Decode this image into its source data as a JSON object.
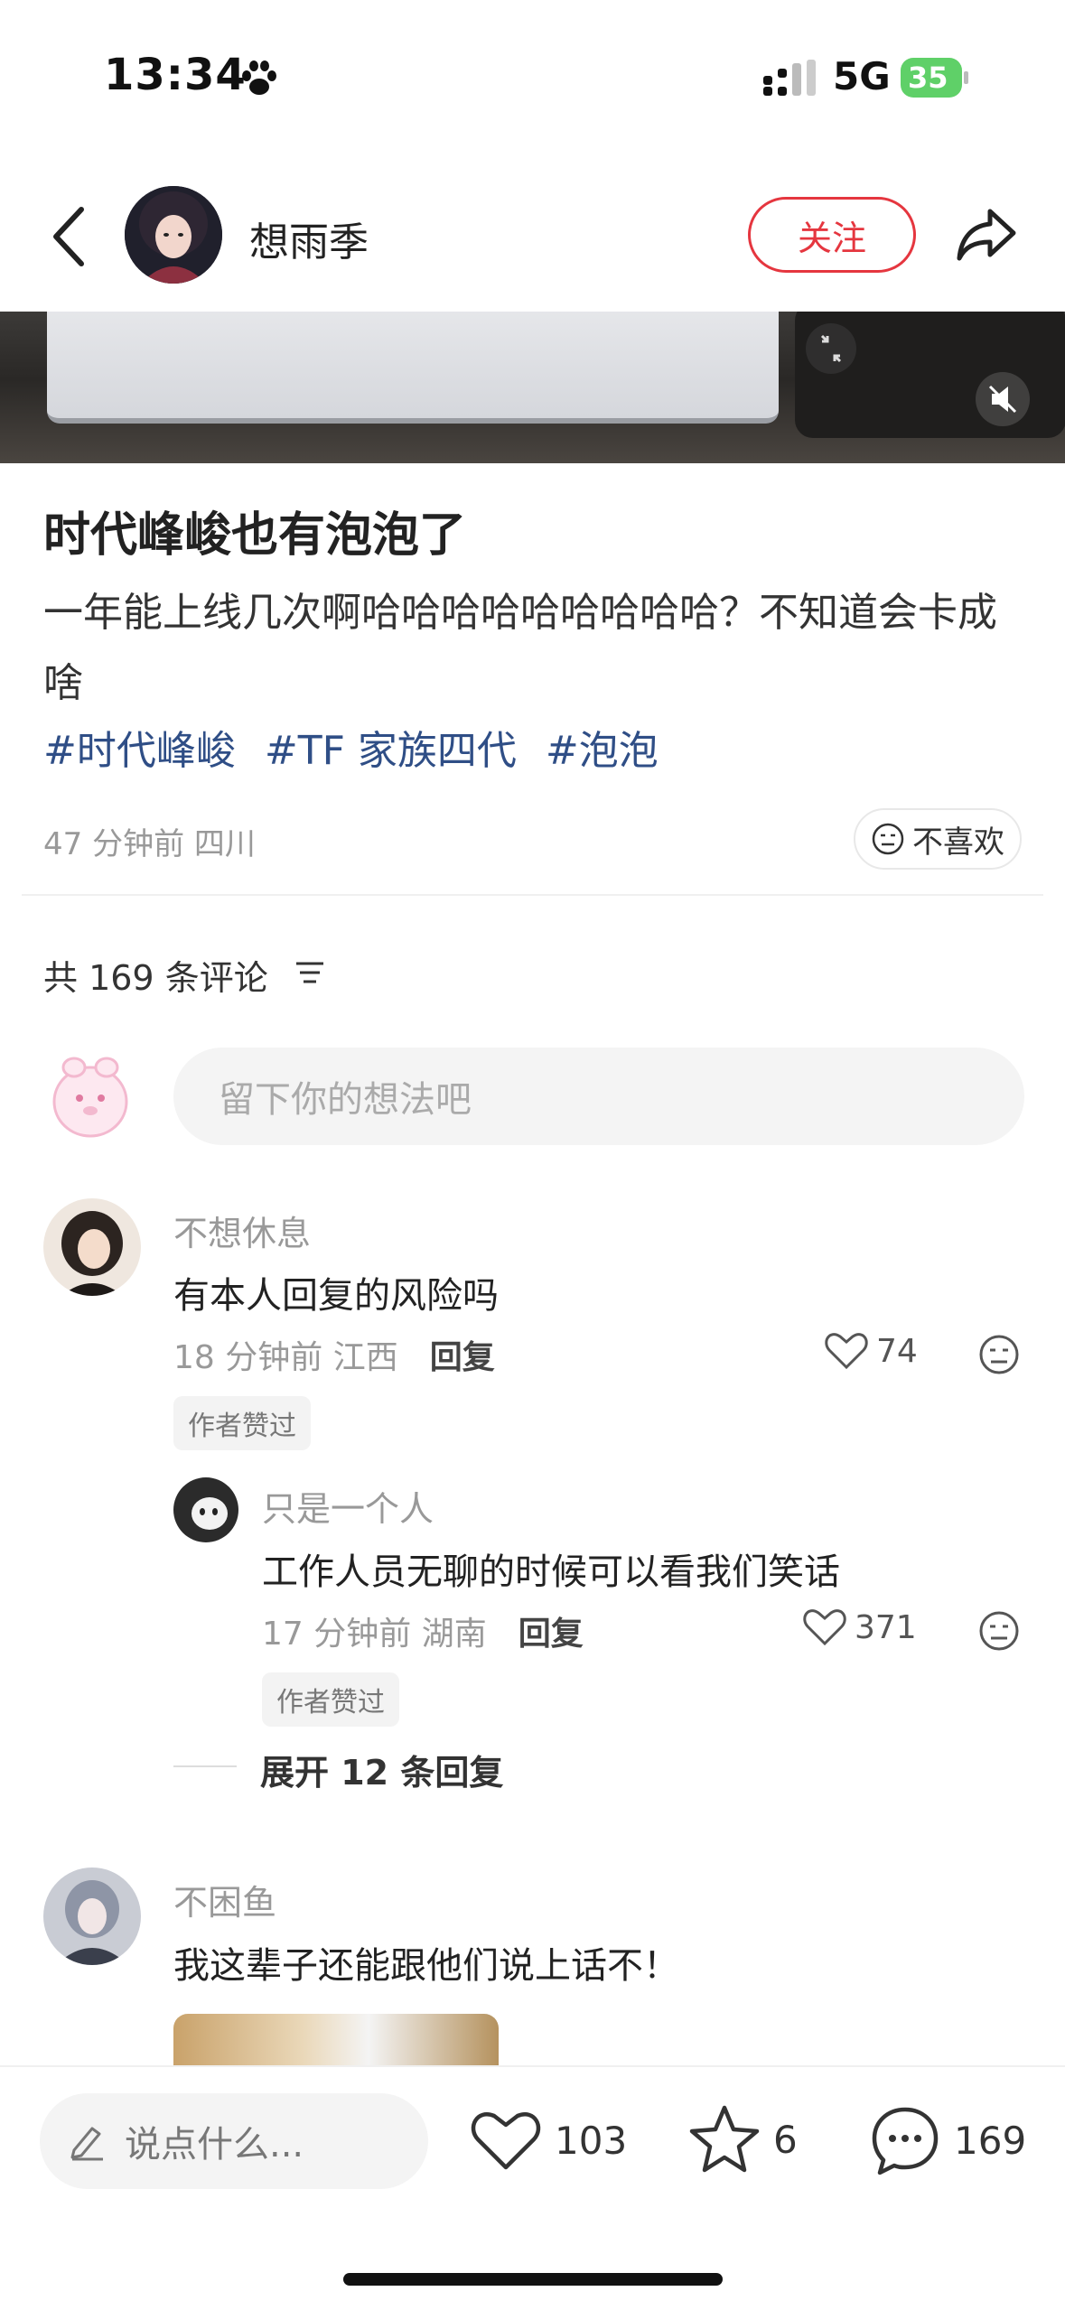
{
  "status_bar": {
    "time": "13:34",
    "network": "5G",
    "battery": "35"
  },
  "header": {
    "author_name": "想雨季",
    "follow_label": "关注"
  },
  "post": {
    "title": "时代峰峻也有泡泡了",
    "body": "一年能上线几次啊哈哈哈哈哈哈哈哈哈？不知道会卡成啥",
    "hashtags": [
      "#时代峰峻",
      "#TF 家族四代",
      "#泡泡"
    ],
    "meta": "47 分钟前  四川",
    "dislike_label": "不喜欢"
  },
  "comments_section": {
    "count_label": "共 169 条评论",
    "input_placeholder": "留下你的想法吧"
  },
  "comments": [
    {
      "name": "不想休息",
      "text": "有本人回复的风险吗",
      "meta": "18 分钟前  江西",
      "reply_label": "回复",
      "likes": "74",
      "tag": "作者赞过"
    },
    {
      "name": "只是一个人",
      "text": "工作人员无聊的时候可以看我们笑话",
      "meta": "17 分钟前  湖南",
      "reply_label": "回复",
      "likes": "371",
      "tag": "作者赞过"
    },
    {
      "name": "不困鱼",
      "text": "我这辈子还能跟他们说上话不！"
    }
  ],
  "expand_replies": "展开 12 条回复",
  "bottom_bar": {
    "say_placeholder": "说点什么...",
    "likes": "103",
    "stars": "6",
    "comments": "169"
  },
  "colors": {
    "accent_red": "#e5363f",
    "hashtag_blue": "#2f4e86",
    "battery_green": "#5fd068"
  },
  "icons": [
    "paw-icon",
    "signal-icon",
    "battery-icon",
    "back-icon",
    "share-icon",
    "collapse-icon",
    "mute-icon",
    "dislike-face-icon",
    "sort-icon",
    "heart-icon",
    "pencil-icon",
    "star-icon",
    "comment-bubble-icon"
  ]
}
